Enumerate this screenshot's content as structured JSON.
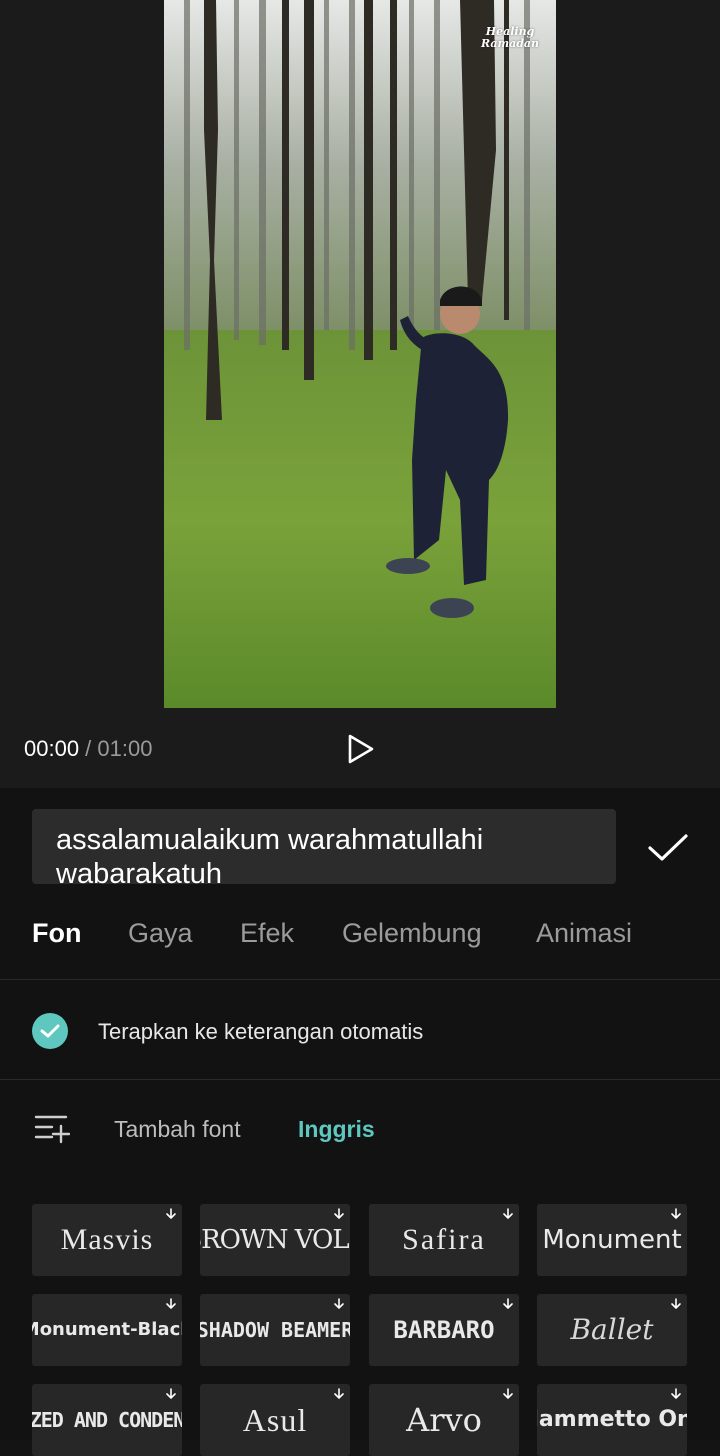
{
  "player": {
    "current_time": "00:00",
    "separator": " / ",
    "total_time": "01:00",
    "watermark": "Healing Ramadan"
  },
  "editor": {
    "text_value": "assalamualaikum warahmatullahi wabarakatuh",
    "tabs": [
      {
        "label": "Fon",
        "active": true
      },
      {
        "label": "Gaya",
        "active": false
      },
      {
        "label": "Efek",
        "active": false
      },
      {
        "label": "Gelembung",
        "active": false
      },
      {
        "label": "Animasi",
        "active": false
      }
    ],
    "auto_caption_label": "Terapkan ke keterangan otomatis",
    "auto_caption_checked": true,
    "add_font_label": "Tambah font",
    "language_label": "Inggris",
    "fonts": [
      "Masvis",
      "BROWN VOLK",
      "Safira",
      "Monument",
      "Monument-Black",
      "SHADOW BEAMER",
      "BARBARO",
      "Ballet",
      "GLAZED AND CONDENSED",
      "Asul",
      "Arvo",
      "Flammetto One"
    ]
  },
  "colors": {
    "accent": "#5ec8c0",
    "background": "#121212",
    "tile": "#272727"
  }
}
